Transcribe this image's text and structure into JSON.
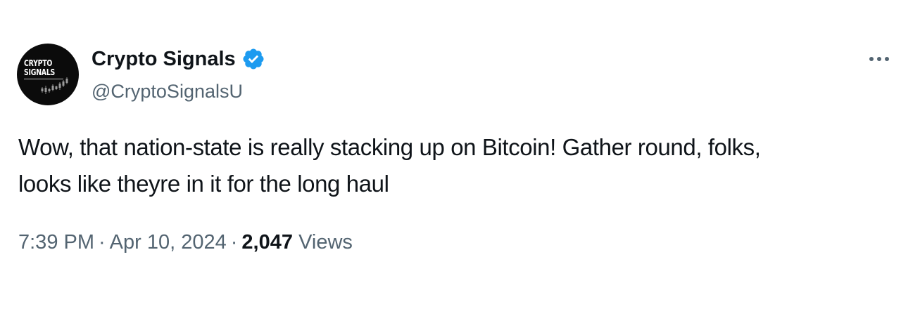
{
  "author": {
    "display_name": "Crypto Signals",
    "handle": "@CryptoSignalsU",
    "verified": true,
    "avatar_text": "CRYPTO\nSIGNALS"
  },
  "icons": {
    "verified": "verified-badge-icon",
    "more": "more-options-icon"
  },
  "tweet": {
    "text_line1": "Wow, that nation-state is really stacking up on Bitcoin! Gather round, folks,",
    "text_line2": "looks like theyre in it for the long haul"
  },
  "meta": {
    "time": "7:39 PM",
    "separator": "·",
    "date": "Apr 10, 2024",
    "views_count": "2,047",
    "views_label": "Views"
  },
  "colors": {
    "text_primary": "#0f1419",
    "text_secondary": "#536471",
    "verified_blue": "#1d9bf0",
    "avatar_bg": "#0b0b0b"
  }
}
